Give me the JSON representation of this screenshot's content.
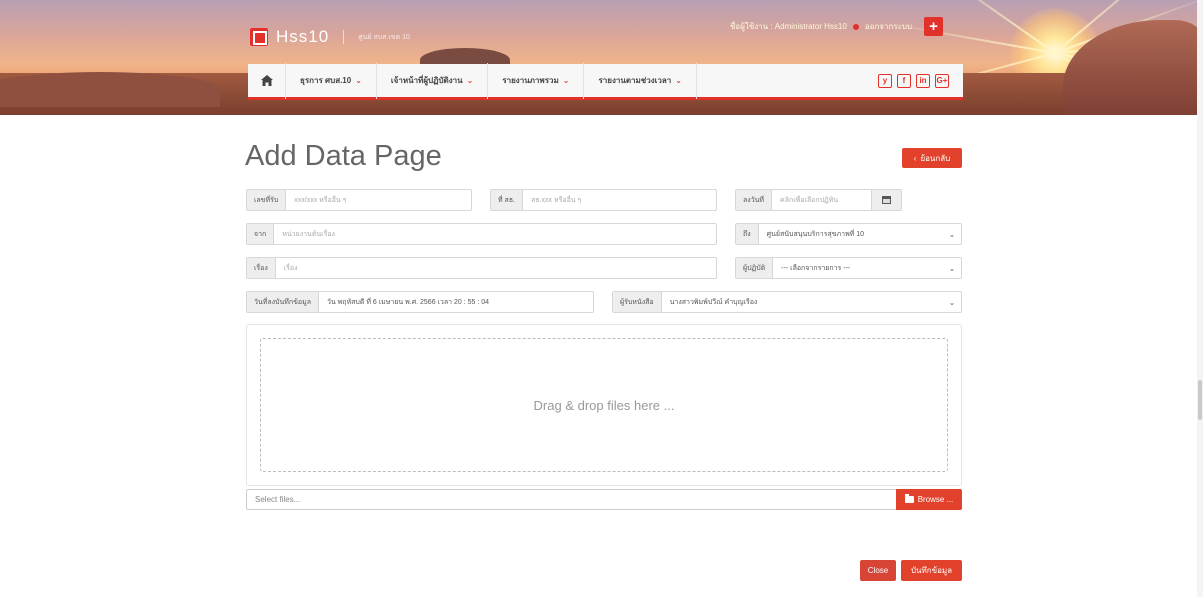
{
  "brand": {
    "name": "Hss10",
    "subtitle": "ศูนย์ สบส.เขต 10"
  },
  "user": {
    "label": "ชื่อผู้ใช้งาน : Administrator Hss10",
    "logout": "ออกจากระบบ",
    "add": "+"
  },
  "nav": {
    "items": [
      {
        "label": "ธุรการ ศบส.10",
        "chevron": "⌄"
      },
      {
        "label": "เจ้าหน้าที่ผู้ปฏิบัติงาน",
        "chevron": "⌄"
      },
      {
        "label": "รายงานภาพรวม",
        "chevron": "⌄"
      },
      {
        "label": "รายงานตามช่วงเวลา",
        "chevron": "⌄"
      }
    ],
    "social": [
      "y",
      "f",
      "in",
      "G+"
    ]
  },
  "page": {
    "title": "Add Data Page",
    "back": "ย้อนกลับ"
  },
  "form": {
    "receive_no": {
      "label": "เลขที่รับ",
      "placeholder": "xxx/xxx หรืออื่น ๆ"
    },
    "ref_no": {
      "label": "ที่ สธ.",
      "placeholder": "สธ.xxx หรืออื่น ๆ"
    },
    "date": {
      "label": "ลงวันที่",
      "placeholder": "คลิกเพื่อเลือกปฏิทิน"
    },
    "from": {
      "label": "จาก",
      "placeholder": "หน่วยงานต้นเรื่อง"
    },
    "to": {
      "label": "ถึง",
      "value": "ศูนย์สนับสนุนบริการสุขภาพที่ 10"
    },
    "subject": {
      "label": "เรื่อง",
      "placeholder": "เรื่อง"
    },
    "officer": {
      "label": "ผู้ปฏิบัติ",
      "value": "--- เลือกจากรายการ ---"
    },
    "record_date": {
      "label": "วันที่ลงบันทึกข้อมูล",
      "value": "วัน พฤหัสบดี ที่ 6 เมษายน พ.ศ. 2566 เวลา 20 : 55 : 04"
    },
    "receiver": {
      "label": "ผู้รับหนังสือ",
      "value": "นางสาวพิมพ์ปวีณ์ คำบุญเรือง"
    }
  },
  "upload": {
    "drop_text": "Drag & drop files here ...",
    "caption": "Select files...",
    "browse": "Browse ..."
  },
  "actions": {
    "close": "Close",
    "save": "บันทึกข้อมูล"
  }
}
